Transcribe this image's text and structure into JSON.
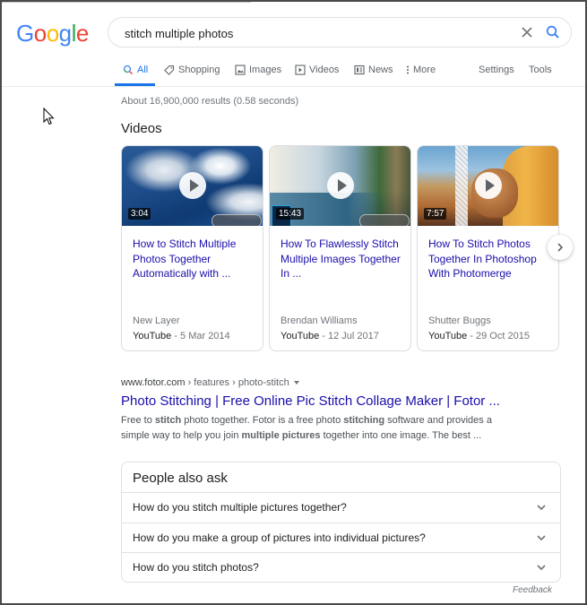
{
  "header": {
    "logo_letters": [
      {
        "char": "G",
        "color": "#4285f4"
      },
      {
        "char": "o",
        "color": "#ea4335"
      },
      {
        "char": "o",
        "color": "#fbbc05"
      },
      {
        "char": "g",
        "color": "#4285f4"
      },
      {
        "char": "l",
        "color": "#34a853"
      },
      {
        "char": "e",
        "color": "#ea4335"
      }
    ],
    "search_value": "stitch multiple photos",
    "clear_icon": "close-icon",
    "search_icon": "search-icon"
  },
  "tabs": [
    {
      "label": "All",
      "icon": "search-icon",
      "active": true
    },
    {
      "label": "Shopping",
      "icon": "tag-icon",
      "active": false
    },
    {
      "label": "Images",
      "icon": "image-icon",
      "active": false
    },
    {
      "label": "Videos",
      "icon": "video-icon",
      "active": false
    },
    {
      "label": "News",
      "icon": "news-icon",
      "active": false
    },
    {
      "label": "More",
      "icon": "more-vertical-icon",
      "active": false
    }
  ],
  "tools": {
    "settings": "Settings",
    "tools": "Tools"
  },
  "result_stats": "About 16,900,000 results (0.58 seconds)",
  "videos": {
    "heading": "Videos",
    "items": [
      {
        "duration": "3:04",
        "title": "How to Stitch Multiple Photos Together Automatically with ...",
        "channel": "New Layer",
        "source": "YouTube",
        "date": "- 5 Mar 2014"
      },
      {
        "duration": "15:43",
        "title": "How To Flawlessly Stitch Multiple Images Together In ...",
        "channel": "Brendan Williams",
        "source": "YouTube",
        "date": "- 12 Jul 2017"
      },
      {
        "duration": "7:57",
        "title": "How To Stitch Photos Together In Photoshop With Photomerge",
        "channel": "Shutter Buggs",
        "source": "YouTube",
        "date": "- 29 Oct 2015"
      }
    ]
  },
  "result": {
    "domain": "www.fotor.com",
    "path": " › features › photo-stitch",
    "title": "Photo Stitching | Free Online Pic Stitch Collage Maker | Fotor ...",
    "snippet_parts": [
      {
        "text": "Free to ",
        "bold": false
      },
      {
        "text": "stitch",
        "bold": true
      },
      {
        "text": " photo together. Fotor is a free photo ",
        "bold": false
      },
      {
        "text": "stitching",
        "bold": true
      },
      {
        "text": " software and provides a simple way to help you join ",
        "bold": false
      },
      {
        "text": "multiple pictures",
        "bold": true
      },
      {
        "text": " together into one image. The best ...",
        "bold": false
      }
    ]
  },
  "people_also_ask": {
    "heading": "People also ask",
    "questions": [
      "How do you stitch multiple pictures together?",
      "How do you make a group of pictures into individual pictures?",
      "How do you stitch photos?"
    ]
  },
  "feedback": "Feedback"
}
